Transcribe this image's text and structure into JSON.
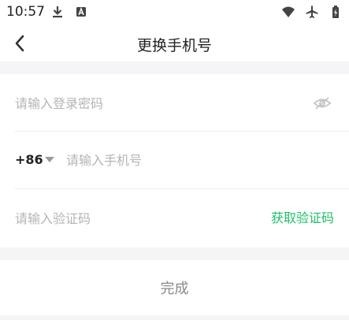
{
  "status_bar": {
    "time": "10:57",
    "left_icons": [
      "download-icon",
      "a-box-icon"
    ],
    "right_icons": [
      "wifi-icon",
      "airplane-icon",
      "battery-icon"
    ]
  },
  "header": {
    "title": "更换手机号",
    "back_icon": "chevron-left-icon"
  },
  "form": {
    "password_placeholder": "请输入登录密码",
    "password_toggle_icon": "eye-off-icon",
    "country_code": "+86",
    "phone_placeholder": "请输入手机号",
    "code_placeholder": "请输入验证码",
    "get_code_label": "获取验证码"
  },
  "submit_label": "完成",
  "colors": {
    "accent": "#1fbf6a",
    "band": "#f5f5f7",
    "placeholder": "#b4b4b4",
    "disabled_text": "#8a8a8a"
  }
}
